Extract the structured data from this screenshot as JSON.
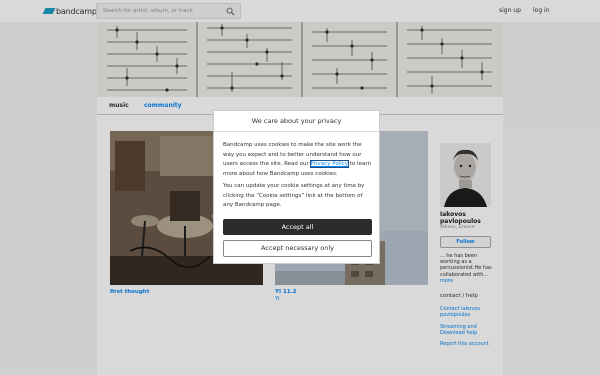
{
  "header": {
    "logo_text": "bandcamp",
    "search_placeholder": "Search for artist, album, or track",
    "signup_label": "sign up",
    "login_label": "log in"
  },
  "tabs": [
    {
      "label": "music",
      "active": true
    },
    {
      "label": "community",
      "active": false
    }
  ],
  "albums": [
    {
      "title": "first thought",
      "artist": ""
    },
    {
      "title": "YI 11.2",
      "artist": "YI"
    }
  ],
  "artist": {
    "name": "Iakovos pavlopoulos",
    "location": "Athens, Greece",
    "follow_label": "Follow",
    "bio_excerpt": "... he has been working as a percussionist.He has collaborated with...",
    "more_label": "more",
    "contact_heading": "contact / help",
    "links": [
      "Contact Iakovos pavlopoulos",
      "Streaming and Download help",
      "Report this account"
    ]
  },
  "cookie_dialog": {
    "title": "We care about your privacy",
    "paragraph1_before": "Bandcamp uses cookies to make the site work the way you expect and to better understand how our users access the site. Read our ",
    "policy_link": "Privacy Policy",
    "paragraph1_after": " to learn more about how Bandcamp uses cookies.",
    "paragraph2": "You can update your cookie settings at any time by clicking the “Cookie settings” link at the bottom of any Bandcamp page.",
    "accept_all_label": "Accept all",
    "accept_necessary_label": "Accept necessary only"
  },
  "colors": {
    "link": "#0687f5",
    "logo": "#1da0c3",
    "button_dark": "#2b2b2b"
  }
}
